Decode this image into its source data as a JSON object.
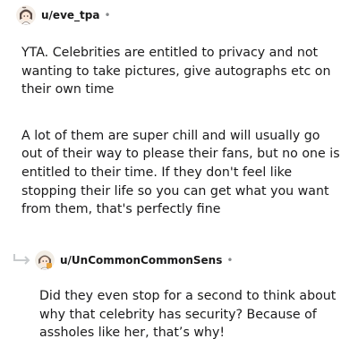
{
  "comments": [
    {
      "username": "u/eve_tpa",
      "separator": "•",
      "paragraphs": [
        "YTA. Celebrities are entitled to privacy and not wanting to take pictures, give autographs etc on their own time",
        "A lot of them are super chill and will usually go out of their way to please their fans, but no one is entitled to their time. If they don't feel like stopping their life so you can get what you want from them, that's perfectly fine"
      ]
    },
    {
      "username": "u/UnCommonCommonSens",
      "separator": "•",
      "paragraphs": [
        "Did they even stop for a second to think about why that celebrity has security? Because of assholes like her, that’s why!"
      ]
    }
  ],
  "colors": {
    "text": "#1a1a1b",
    "meta": "#878a8c",
    "reply_arrow": "#c8cbcd"
  },
  "icons": [
    "avatar",
    "reply-arrow-icon"
  ]
}
